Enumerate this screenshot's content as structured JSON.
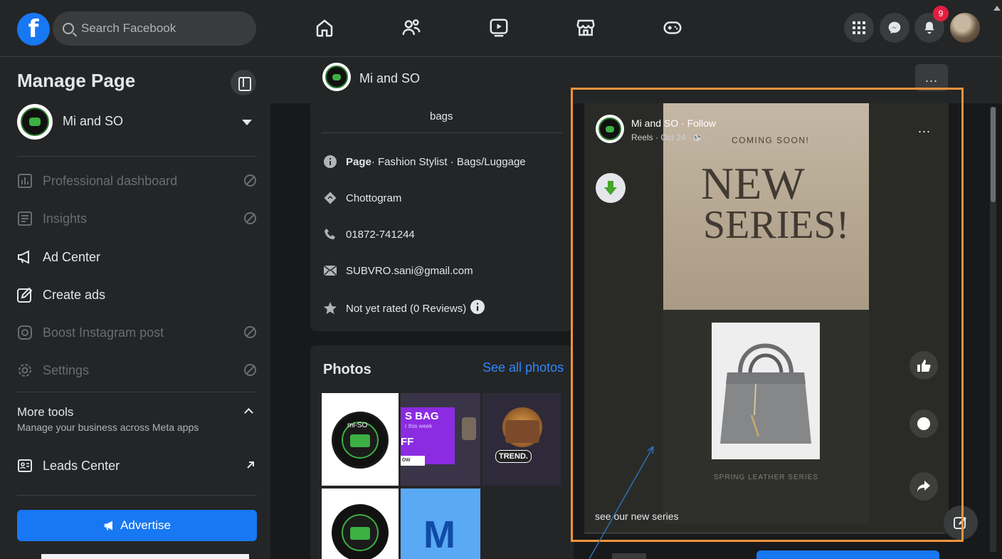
{
  "topbar": {
    "search_placeholder": "Search Facebook",
    "notification_count": "9",
    "nav_icons": [
      "home-icon",
      "friends-icon",
      "watch-icon",
      "marketplace-icon",
      "gaming-icon"
    ]
  },
  "sidebar": {
    "title": "Manage Page",
    "page_name": "Mi and SO",
    "items": [
      {
        "label": "Professional dashboard",
        "disabled": true
      },
      {
        "label": "Insights",
        "disabled": true
      },
      {
        "label": "Ad Center",
        "disabled": false
      },
      {
        "label": "Create ads",
        "disabled": false
      },
      {
        "label": "Boost Instagram post",
        "disabled": true
      },
      {
        "label": "Settings",
        "disabled": true
      }
    ],
    "more_tools": {
      "title": "More tools",
      "subtitle": "Manage your business across Meta apps"
    },
    "leads_center": "Leads Center",
    "advertise_label": "Advertise"
  },
  "page_header": {
    "name": "Mi and SO",
    "more": "..."
  },
  "intro": {
    "bags": "bags",
    "category_prefix": "Page",
    "category": " · Fashion Stylist · Bags/Luggage",
    "location": "Chottogram",
    "phone": "01872-741244",
    "email": "SUBVRO.sani@gmail.com",
    "rating": "Not yet rated (0 Reviews)"
  },
  "photos": {
    "title": "Photos",
    "see_all": "See all photos",
    "thumb1_badge": "mi-SO",
    "thumb2_title": "S BAG",
    "thumb2_sub": "r this week",
    "thumb2_off": "FF",
    "thumb2_btn": "ow",
    "thumb3_label": "TREND.",
    "thumb5_letter": "M"
  },
  "reel": {
    "author": "Mi and SO · Follow",
    "meta": "Reels · Oct 24 ·",
    "more": "...",
    "coming_soon": "COMING SOON!",
    "headline_new": "NEW",
    "headline_series": "SERIES!",
    "product_caption": "SPRING LEATHER SERIES",
    "caption": "see our new series"
  },
  "colors": {
    "accent": "#1877f2",
    "highlight_box": "#f0933c",
    "link": "#2d88ff",
    "notification": "#e41e3f"
  }
}
